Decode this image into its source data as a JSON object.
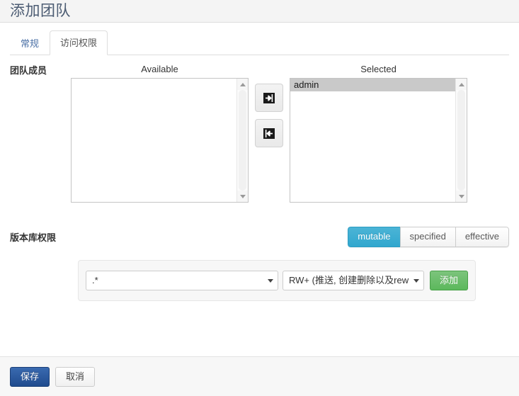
{
  "header": {
    "title": "添加团队"
  },
  "tabs": [
    {
      "label": "常规",
      "active": false
    },
    {
      "label": "访问权限",
      "active": true
    }
  ],
  "members": {
    "label": "团队成员",
    "available": {
      "heading": "Available",
      "items": []
    },
    "selected": {
      "heading": "Selected",
      "items": [
        {
          "label": "admin",
          "selected": true
        }
      ]
    },
    "move_right_icon": "sign-in-icon",
    "move_left_icon": "sign-out-icon"
  },
  "permissions": {
    "label": "版本库权限",
    "modes": [
      {
        "label": "mutable",
        "active": true
      },
      {
        "label": "specified",
        "active": false
      },
      {
        "label": "effective",
        "active": false
      }
    ],
    "accent_active": "#31a7ce",
    "rule": {
      "ref_value": ".*",
      "permission_value": "RW+ (推送, 创建删除以及rewir",
      "add_label": "添加",
      "add_color": "#5cb85c"
    }
  },
  "footer": {
    "save_label": "保存",
    "cancel_label": "取消",
    "save_color": "#1f4b8e"
  }
}
